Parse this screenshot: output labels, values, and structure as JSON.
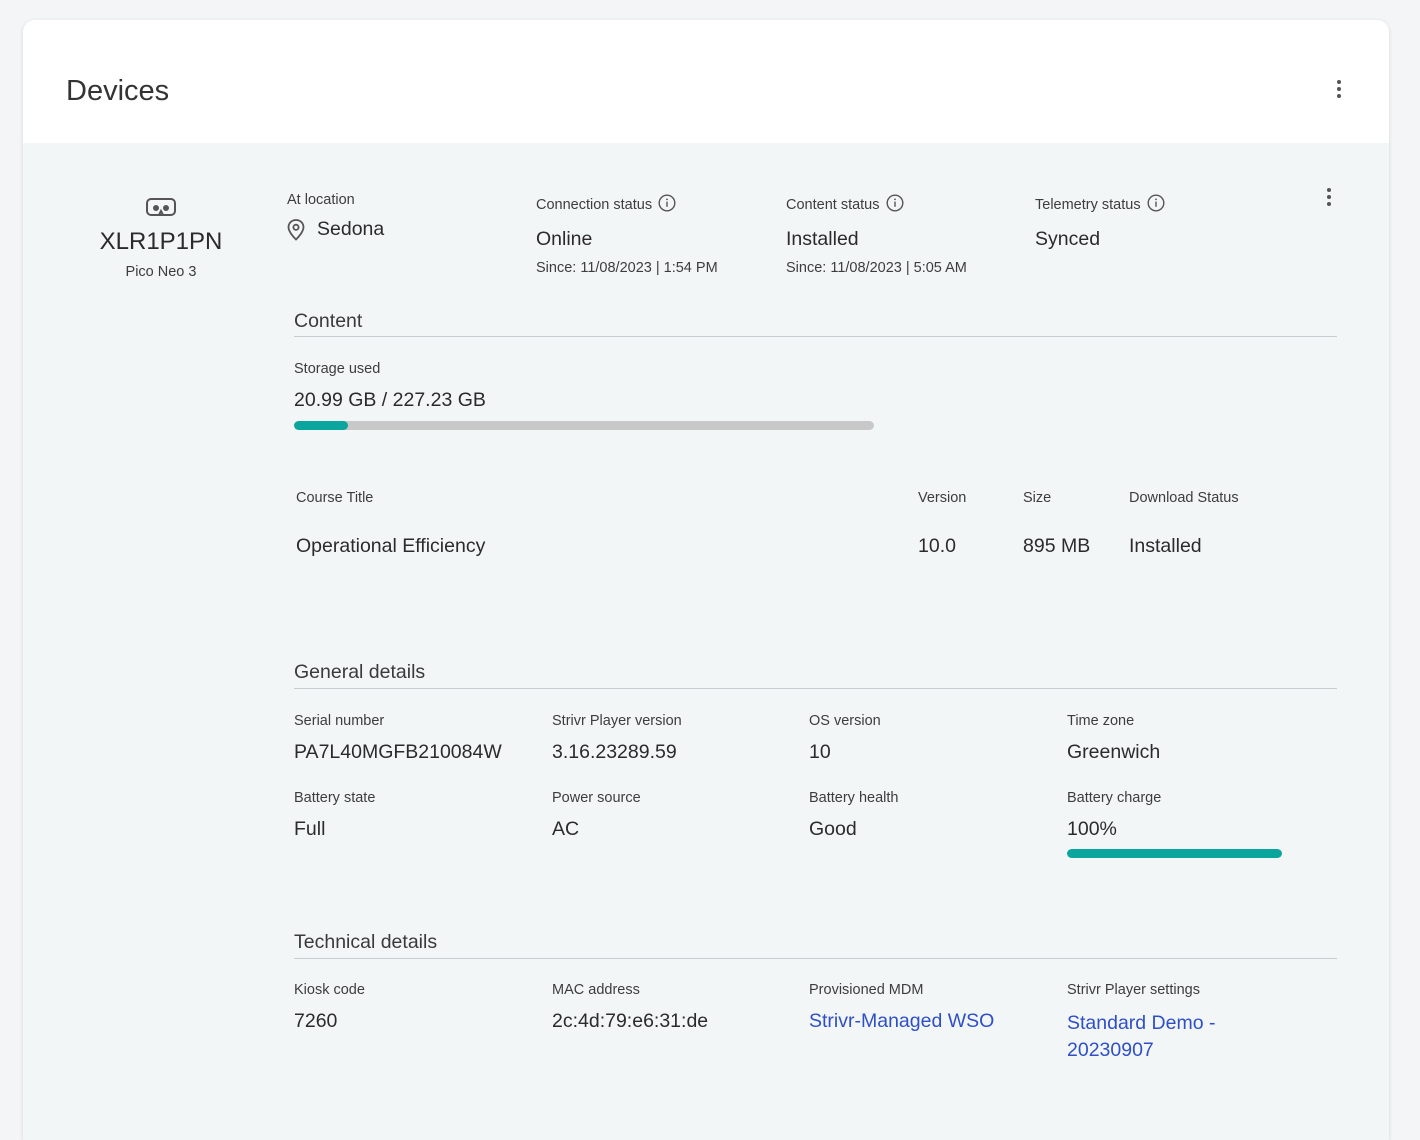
{
  "header": {
    "title": "Devices"
  },
  "device": {
    "icon": "vr-headset-icon",
    "name": "XLR1P1PN",
    "model": "Pico Neo 3",
    "location_label": "At location",
    "location_icon": "map-pin-icon",
    "location_value": "Sedona",
    "connection": {
      "label": "Connection status",
      "value": "Online",
      "since": "Since: 11/08/2023 | 1:54 PM"
    },
    "content_status": {
      "label": "Content status",
      "value": "Installed",
      "since": "Since: 11/08/2023 | 5:05 AM"
    },
    "telemetry": {
      "label": "Telemetry status",
      "value": "Synced"
    }
  },
  "content": {
    "title": "Content",
    "storage_label": "Storage used",
    "storage_value": "20.99 GB / 227.23 GB",
    "storage_fraction": 0.0924,
    "table": {
      "headers": {
        "course": "Course Title",
        "version": "Version",
        "size": "Size",
        "status": "Download Status"
      },
      "rows": [
        {
          "course": "Operational Efficiency",
          "version": "10.0",
          "size": "895 MB",
          "status": "Installed"
        }
      ]
    }
  },
  "general": {
    "title": "General details",
    "serial": {
      "label": "Serial number",
      "value": "PA7L40MGFB210084W"
    },
    "player_version": {
      "label": "Strivr Player version",
      "value": "3.16.23289.59"
    },
    "os_version": {
      "label": "OS version",
      "value": "10"
    },
    "time_zone": {
      "label": "Time zone",
      "value": "Greenwich"
    },
    "battery_state": {
      "label": "Battery state",
      "value": "Full"
    },
    "power_source": {
      "label": "Power source",
      "value": "AC"
    },
    "battery_health": {
      "label": "Battery health",
      "value": "Good"
    },
    "battery_charge": {
      "label": "Battery charge",
      "value": "100%",
      "fraction": 1.0
    }
  },
  "technical": {
    "title": "Technical details",
    "kiosk": {
      "label": "Kiosk code",
      "value": "7260"
    },
    "mac": {
      "label": "MAC address",
      "value": "2c:4d:79:e6:31:de"
    },
    "mdm": {
      "label": "Provisioned MDM",
      "value": "Strivr-Managed WSO"
    },
    "settings": {
      "label": "Strivr Player settings",
      "value_line1": "Standard Demo -",
      "value_line2": "20230907"
    }
  },
  "colors": {
    "accent": "#0aa59c",
    "link": "#2f4fc6",
    "track": "#c8c8c8"
  }
}
